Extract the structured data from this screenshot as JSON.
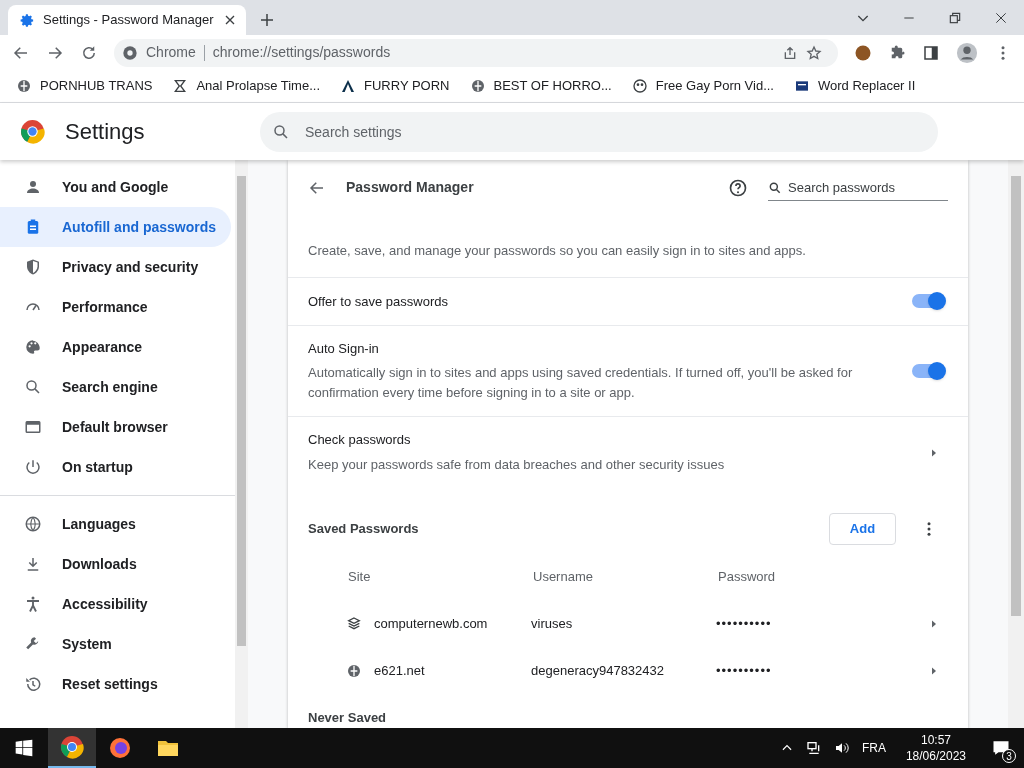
{
  "browser": {
    "tab_title": "Settings - Password Manager",
    "address_label": "Chrome",
    "address_url": "chrome://settings/passwords",
    "bookmarks": [
      {
        "label": "PORNHUB TRANS"
      },
      {
        "label": "Anal Prolapse Time..."
      },
      {
        "label": "FURRY PORN"
      },
      {
        "label": "BEST OF HORRO..."
      },
      {
        "label": "Free Gay Porn Vid..."
      },
      {
        "label": "Word Replacer II"
      }
    ]
  },
  "settings_header": {
    "title": "Settings",
    "search_placeholder": "Search settings"
  },
  "sidebar": {
    "groups": [
      [
        {
          "label": "You and Google",
          "selected": false
        },
        {
          "label": "Autofill and passwords",
          "selected": true
        },
        {
          "label": "Privacy and security",
          "selected": false
        },
        {
          "label": "Performance",
          "selected": false
        },
        {
          "label": "Appearance",
          "selected": false
        },
        {
          "label": "Search engine",
          "selected": false
        },
        {
          "label": "Default browser",
          "selected": false
        },
        {
          "label": "On startup",
          "selected": false
        }
      ],
      [
        {
          "label": "Languages",
          "selected": false
        },
        {
          "label": "Downloads",
          "selected": false
        },
        {
          "label": "Accessibility",
          "selected": false
        },
        {
          "label": "System",
          "selected": false
        },
        {
          "label": "Reset settings",
          "selected": false
        }
      ]
    ]
  },
  "page": {
    "title": "Password Manager",
    "search_placeholder": "Search passwords",
    "description": "Create, save, and manage your passwords so you can easily sign in to sites and apps.",
    "rows": [
      {
        "kind": "toggle",
        "title": "Offer to save passwords",
        "on": true
      },
      {
        "kind": "toggle",
        "title": "Auto Sign-in",
        "subtitle": "Automatically sign in to sites and apps using saved credentials. If turned off, you'll be asked for confirmation every time before signing in to a site or app.",
        "on": true
      },
      {
        "kind": "link",
        "title": "Check passwords",
        "subtitle": "Keep your passwords safe from data breaches and other security issues"
      }
    ],
    "saved": {
      "title": "Saved Passwords",
      "add_button": "Add",
      "columns": [
        "Site",
        "Username",
        "Password"
      ],
      "rows": [
        {
          "site": "computernewb.com",
          "username": "viruses",
          "password": "••••••••••"
        },
        {
          "site": "e621.net",
          "username": "degeneracy947832432",
          "password": "••••••••••"
        }
      ]
    },
    "next_section": "Never Saved"
  },
  "taskbar": {
    "language": "FRA",
    "time": "10:57",
    "date": "18/06/2023",
    "notifications": "3"
  }
}
